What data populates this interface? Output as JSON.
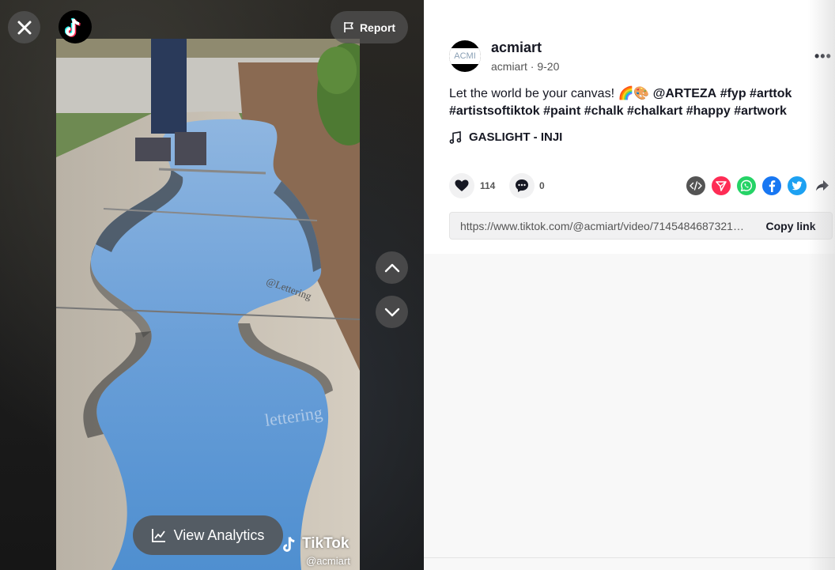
{
  "video": {
    "report_label": "Report",
    "analytics_label": "View Analytics",
    "watermark_brand": "TikTok",
    "watermark_user": "@acmiart",
    "icons": [
      "close-icon",
      "tiktok-logo",
      "flag-icon",
      "chevron-up-icon",
      "chevron-down-icon",
      "analytics-chart-icon"
    ]
  },
  "post": {
    "avatar_text": "ACMI",
    "username": "acmiart",
    "handle": "acmiart",
    "separator": " · ",
    "date": "9-20",
    "more_label": "•••",
    "caption_text": "Let the world be your canvas! ",
    "caption_emoji": "🌈🎨",
    "caption_tags": [
      "@ARTEZA",
      "#fyp",
      "#arttok",
      "#artistsoftiktok",
      "#paint",
      "#chalk",
      "#chalkart",
      "#happy",
      "#artwork"
    ],
    "music": "GASLIGHT - INJI",
    "likes": "114",
    "comments": "0",
    "share_icons": [
      "embed-icon",
      "send-to-friends-icon",
      "whatsapp-icon",
      "facebook-icon",
      "twitter-icon",
      "share-arrow-icon"
    ],
    "link_url": "https://www.tiktok.com/@acmiart/video/714548468732105...",
    "copy_label": "Copy link"
  },
  "colors": {
    "send_red": "#fe2c55",
    "whatsapp": "#25d366",
    "facebook": "#1877f2",
    "twitter": "#1da1f2",
    "embed": "#545454",
    "chalk_blue": "#6a9fd8"
  }
}
